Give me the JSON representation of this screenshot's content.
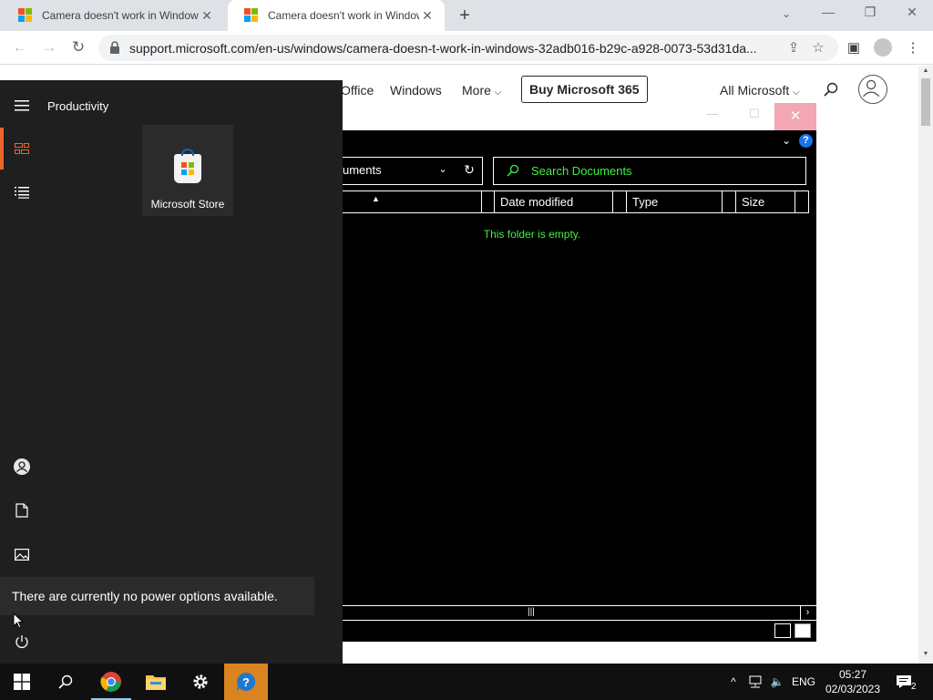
{
  "browser": {
    "tabs": [
      {
        "title": "Camera doesn't work in Windows",
        "active": false
      },
      {
        "title": "Camera doesn't work in Windows",
        "active": true
      }
    ],
    "new_tab_label": "+",
    "url": "support.microsoft.com/en-us/windows/camera-doesn-t-work-in-windows-32adb016-b29c-a928-0073-53d31da...",
    "colors": {
      "tabstrip": "#dee1e6",
      "omnibox": "#f1f3f4"
    }
  },
  "ms_header": {
    "links": [
      "Office",
      "Windows",
      "More"
    ],
    "buy_label": "Buy Microsoft 365",
    "all_microsoft_label": "All Microsoft"
  },
  "file_dialog": {
    "path_text": "uments",
    "search_placeholder": "Search Documents",
    "columns": [
      "Date modified",
      "Type",
      "Size"
    ],
    "empty_message": "This folder is empty.",
    "colors": {
      "background": "#000000",
      "highlight_text": "#3ff23f",
      "close_button": "#f3a6b3"
    }
  },
  "start_menu": {
    "group_title": "Productivity",
    "tiles": [
      {
        "label": "Microsoft Store",
        "icon": "microsoft-store-icon"
      }
    ],
    "rail_icons": [
      "hamburger-menu-icon",
      "tiles-icon",
      "list-icon",
      "user-icon",
      "document-icon",
      "pictures-icon",
      "power-icon"
    ],
    "power_tooltip": "There are currently no power options available.",
    "colors": {
      "background": "#1f1f1f",
      "accent": "#e8662b"
    }
  },
  "taskbar": {
    "apps": [
      "windows-start-icon",
      "search-icon",
      "chrome-icon",
      "file-explorer-icon",
      "settings-icon",
      "get-help-icon"
    ],
    "language": "ENG",
    "time": "05:27",
    "date": "02/03/2023",
    "notification_count": "2"
  }
}
